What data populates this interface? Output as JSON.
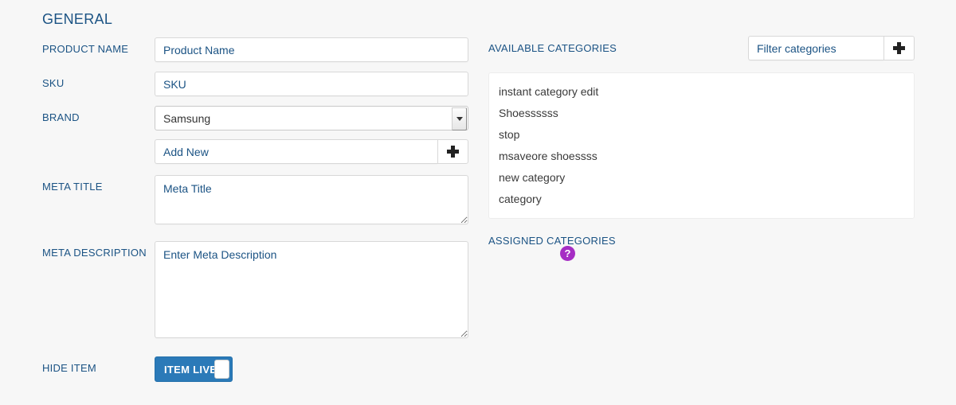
{
  "general": {
    "section_title": "GENERAL",
    "fields": {
      "product_name": {
        "label": "PRODUCT NAME",
        "placeholder": "Product Name",
        "value": ""
      },
      "sku": {
        "label": "SKU",
        "placeholder": "SKU",
        "value": ""
      },
      "brand": {
        "label": "BRAND",
        "selected": "Samsung",
        "options": [
          "Samsung"
        ]
      },
      "add_new_brand": {
        "placeholder": "Add New",
        "value": "",
        "add_button_icon": "plus-icon"
      },
      "meta_title": {
        "label": "META TITLE",
        "placeholder": "Meta Title",
        "value": "",
        "help_icon": "question-mark-icon"
      },
      "meta_description": {
        "label": "META DESCRIPTION",
        "placeholder": "Enter Meta Description",
        "value": "",
        "help_icon": "question-mark-icon"
      },
      "hide_item": {
        "label": "HIDE ITEM",
        "toggle_label": "ITEM LIVE",
        "state": "on"
      }
    }
  },
  "categories": {
    "available_label": "AVAILABLE CATEGORIES",
    "filter": {
      "placeholder": "Filter categories",
      "value": "",
      "add_button_icon": "plus-icon"
    },
    "available_items": [
      "instant category edit",
      "Shoessssss",
      "stop",
      "msaveore shoessss",
      "new category",
      "category"
    ],
    "assigned_label": "ASSIGNED CATEGORIES",
    "assigned_items": []
  },
  "colors": {
    "label_blue": "#1b5384",
    "toggle_blue": "#2b7ab8",
    "help_purple": "#a62dc4",
    "page_bg": "#f7f7f7",
    "field_text": "#1b5384",
    "list_text": "#3a3a3a"
  }
}
